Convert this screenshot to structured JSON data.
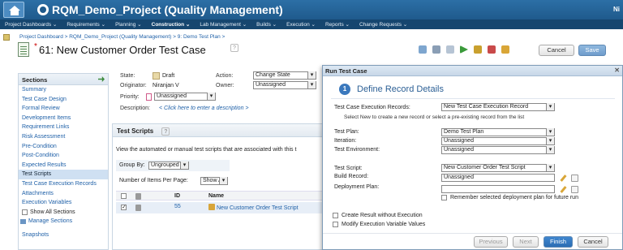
{
  "banner": {
    "title": "RQM_Demo_Project (Quality Management)",
    "user": "Ni"
  },
  "nav": [
    {
      "label": "Project Dashboards ⌄"
    },
    {
      "label": "Requirements ⌄"
    },
    {
      "label": "Planning ⌄"
    },
    {
      "label": "Construction ⌄"
    },
    {
      "label": "Lab Management ⌄"
    },
    {
      "label": "Builds ⌄"
    },
    {
      "label": "Execution ⌄"
    },
    {
      "label": "Reports ⌄"
    },
    {
      "label": "Change Requests ⌄"
    }
  ],
  "breadcrumb": "Project Dashboard > RQM_Demo_Project (Quality Management) > 9: Demo Test Plan >",
  "page": {
    "asterisk": "*",
    "title": "61: New Customer Order Test Case",
    "help": "?"
  },
  "buttons": {
    "cancel": "Cancel",
    "save": "Save"
  },
  "sidebar": {
    "header": "Sections",
    "items": [
      "Summary",
      "Test Case Design",
      "Formal Review",
      "Development Items",
      "Requirement Links",
      "Risk Assessment",
      "Pre-Condition",
      "Post-Condition",
      "Expected Results",
      "Test Scripts",
      "Test Case Execution Records",
      "Attachments",
      "Execution Variables"
    ],
    "selected_item": "Test Scripts",
    "show_all": "Show All Sections",
    "manage": "Manage Sections",
    "snapshots": "Snapshots"
  },
  "summary": {
    "state_label": "State:",
    "state_value": "Draft",
    "action_label": "Action:",
    "action_value": "Change State",
    "originator_label": "Originator:",
    "originator_value": "Niranjan V",
    "owner_label": "Owner:",
    "owner_value": "Unassigned",
    "priority_label": "Priority:",
    "priority_value": "Unassigned",
    "description_label": "Description:",
    "description_value": "< Click here to enter a description >"
  },
  "scripts": {
    "title": "Test Scripts",
    "help": "?",
    "description": "View the automated or manual test scripts that are associated with this t",
    "group_by_label": "Group By:",
    "group_by_value": "Ungrouped",
    "per_page_label": "Number of Items Per Page:",
    "per_page_value": "Show All",
    "columns": {
      "id": "ID",
      "name": "Name"
    },
    "row": {
      "id": "55",
      "name": "New Customer Order Test Script"
    }
  },
  "dialog": {
    "title": "Run Test Case",
    "step_number": "1",
    "step_title": "Define Record Details",
    "tcer_label": "Test Case Execution Records:",
    "tcer_value": "New Test Case Execution Record",
    "tcer_hint": "Select New to create a new record or select a pre-existing record from the list",
    "test_plan_label": "Test Plan:",
    "test_plan_value": "Demo Test Plan",
    "iteration_label": "Iteration:",
    "iteration_value": "Unassigned",
    "environment_label": "Test Environment:",
    "environment_value": "Unassigned",
    "script_label": "Test Script:",
    "script_value": "New Customer Order Test Script",
    "build_label": "Build Record:",
    "build_value": "Unassigned",
    "deploy_label": "Deployment Plan:",
    "deploy_value": "",
    "remember_label": "Remember selected deployment plan for future run",
    "create_without_label": "Create Result without Execution",
    "modify_vars_label": "Modify Execution Variable Values",
    "previous": "Previous",
    "next": "Next",
    "finish": "Finish",
    "cancel": "Cancel"
  }
}
